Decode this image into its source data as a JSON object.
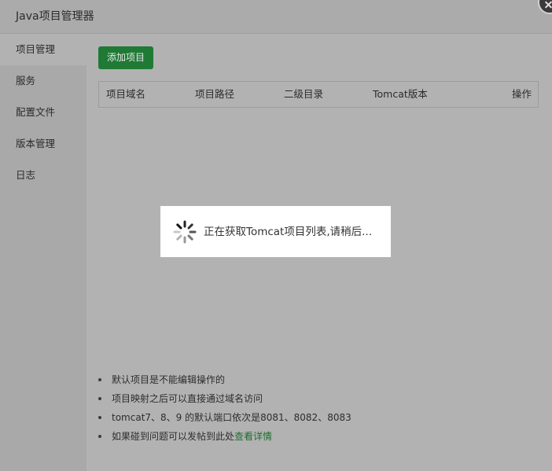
{
  "window": {
    "title": "Java项目管理器"
  },
  "sidebar": {
    "items": [
      {
        "label": "项目管理"
      },
      {
        "label": "服务"
      },
      {
        "label": "配置文件"
      },
      {
        "label": "版本管理"
      },
      {
        "label": "日志"
      }
    ],
    "active_index": 0
  },
  "toolbar": {
    "add_label": "添加项目"
  },
  "table": {
    "columns": [
      "项目域名",
      "项目路径",
      "二级目录",
      "Tomcat版本",
      "操作"
    ],
    "rows": []
  },
  "notes": {
    "items": [
      "默认项目是不能编辑操作的",
      "项目映射之后可以直接通过域名访问",
      "tomcat7、8、9 的默认端口依次是8081、8082、8083",
      "如果碰到问题可以发帖到此处"
    ],
    "link_label": "查看详情"
  },
  "loading": {
    "message": "正在获取Tomcat项目列表,请稍后..."
  },
  "colors": {
    "accent_green": "#1f7a35",
    "link_green": "#1d6e2e",
    "overlay_gray": "#b2b2b2",
    "sidebar_gray": "#a9a9a9"
  }
}
